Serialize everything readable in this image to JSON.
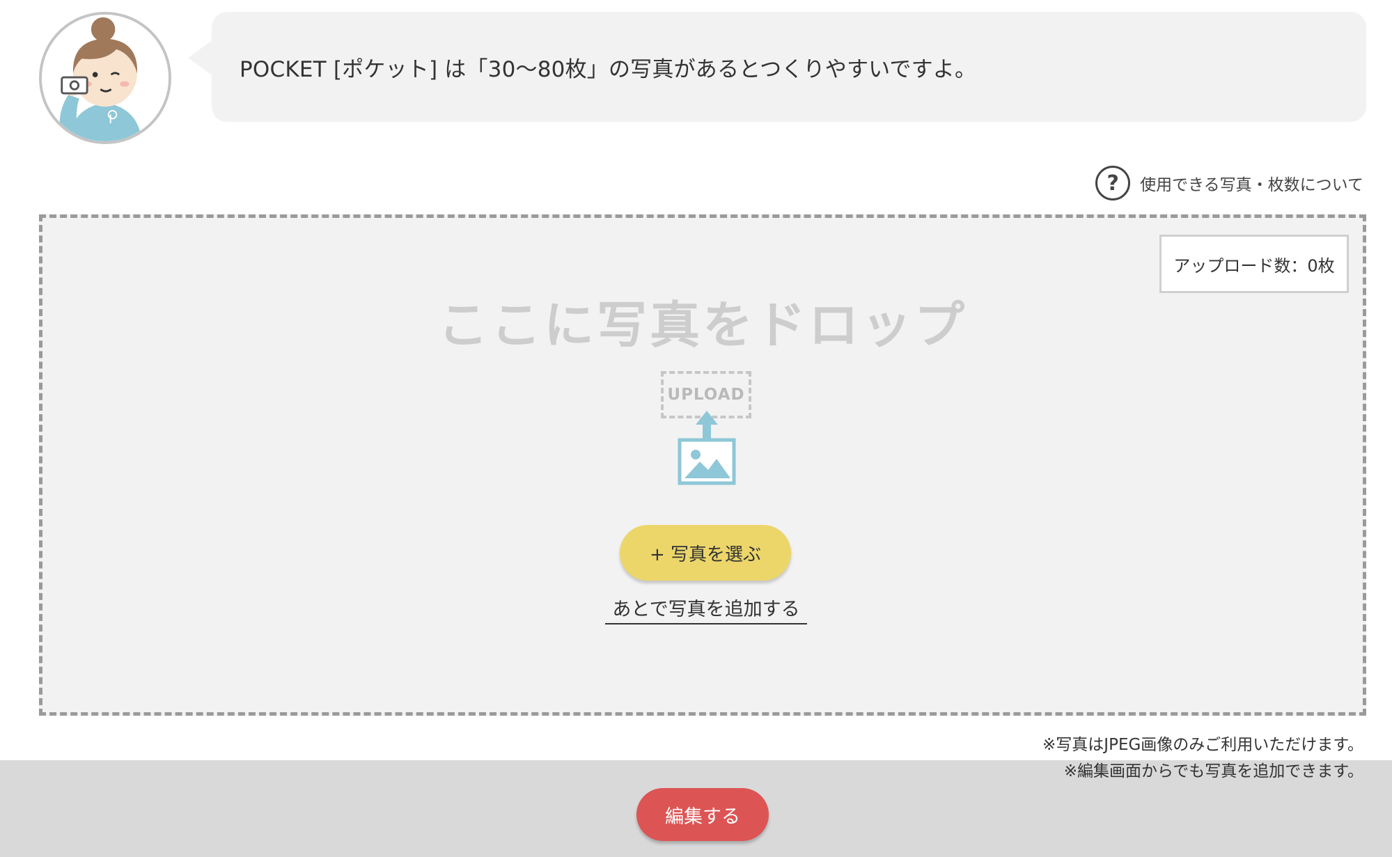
{
  "bubble": {
    "message": "POCKET [ポケット] は「30〜80枚」の写真があるとつくりやすいですよ。"
  },
  "help": {
    "icon": "help-circle-icon",
    "glyph": "?",
    "label": "使用できる写真・枚数について"
  },
  "dropzone": {
    "upload_count": "アップロード数：0枚",
    "title": "ここに写真をドロップ",
    "upload_label": "UPLOAD",
    "choose_button": "+ 写真を選ぶ",
    "later_link": "あとで写真を追加する"
  },
  "notes": {
    "jpeg_only": "※写真はJPEG画像のみご利用いただけます。",
    "add_later": "※編集画面からでも写真を追加できます。"
  },
  "footer": {
    "edit_button": "編集する"
  },
  "colors": {
    "accent_yellow": "#ecd66a",
    "accent_red": "#dd5454",
    "icon_blue": "#8ec7d7"
  }
}
